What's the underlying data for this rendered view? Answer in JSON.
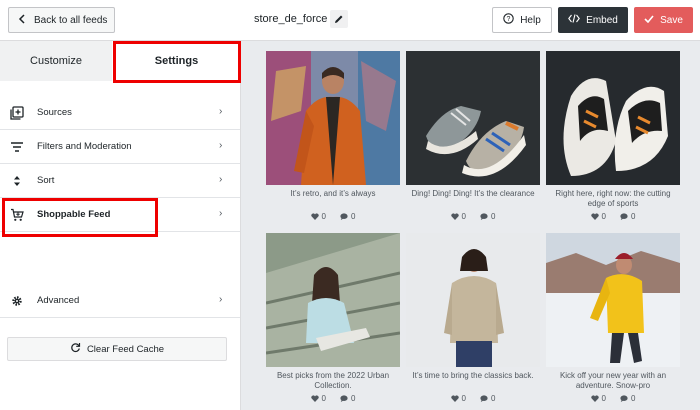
{
  "header": {
    "back_label": "Back to all feeds",
    "feed_name": "store_de_force",
    "help_label": "Help",
    "embed_label": "Embed",
    "save_label": "Save"
  },
  "sidebar": {
    "tabs": [
      {
        "label": "Customize",
        "active": false
      },
      {
        "label": "Settings",
        "active": true
      }
    ],
    "items": [
      {
        "label": "Sources",
        "icon": "add-box-icon"
      },
      {
        "label": "Filters and Moderation",
        "icon": "filter-icon"
      },
      {
        "label": "Sort",
        "icon": "sort-icon"
      },
      {
        "label": "Shoppable Feed",
        "icon": "cart-icon"
      },
      {
        "label": "Advanced",
        "icon": "gear-icon"
      }
    ],
    "clear_cache_label": "Clear Feed Cache"
  },
  "posts": [
    {
      "caption": "It’s retro, and it’s always",
      "likes": "0",
      "comments": "0"
    },
    {
      "caption": "Ding! Ding! Ding! It’s the clearance",
      "likes": "0",
      "comments": "0"
    },
    {
      "caption": "Right here, right now: the cutting edge of sports",
      "likes": "0",
      "comments": "0"
    },
    {
      "caption": "Best picks from the 2022 Urban Collection.",
      "likes": "0",
      "comments": "0"
    },
    {
      "caption": "It’s time to bring the classics back.",
      "likes": "0",
      "comments": "0"
    },
    {
      "caption": "Kick off your new year with an adventure. Snow-pro",
      "likes": "0",
      "comments": "0"
    }
  ],
  "colors": {
    "embed_bg": "#2c3338",
    "save_bg": "#e35c5c",
    "highlight": "#e00000"
  }
}
